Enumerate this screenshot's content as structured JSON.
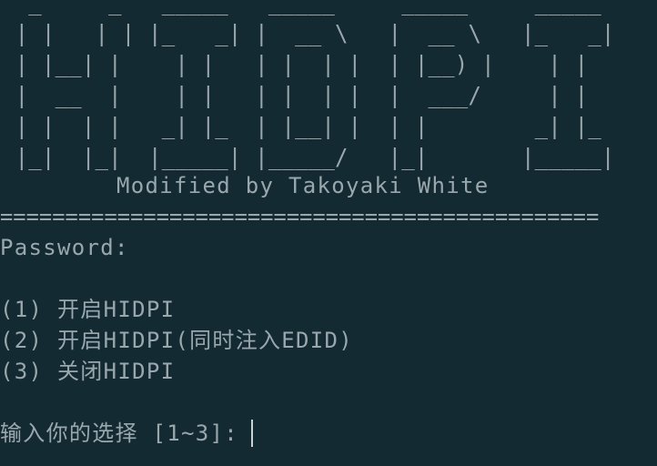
{
  "banner": {
    "ascii_art": "  _     _   _____   _____     _____     _____ \n | |   | | |_   _| |  __ \\   |  __ \\   |_   _|\n | |__| |    | |   | |  | |  | |__) |    | |  \n |  __  |    | |   | |  | |  |  ___/     | |  \n | |  | |   _| |_  | |__| |  | |        _| |_ \n |_|  |_|  |_____| |_____/   |_|       |_____|",
    "credit": "Modified by Takoyaki White"
  },
  "separator": "==============================================",
  "password_label": "Password:",
  "menu": {
    "options": [
      "(1) 开启HIDPI",
      "(2) 开启HIDPI(同时注入EDID)",
      "(3) 关闭HIDPI"
    ]
  },
  "prompt": {
    "text": "输入你的选择 [1~3]:"
  },
  "colors": {
    "background": "#132a33",
    "text": "#9aa7ad",
    "cursor": "#c9d3d6"
  }
}
